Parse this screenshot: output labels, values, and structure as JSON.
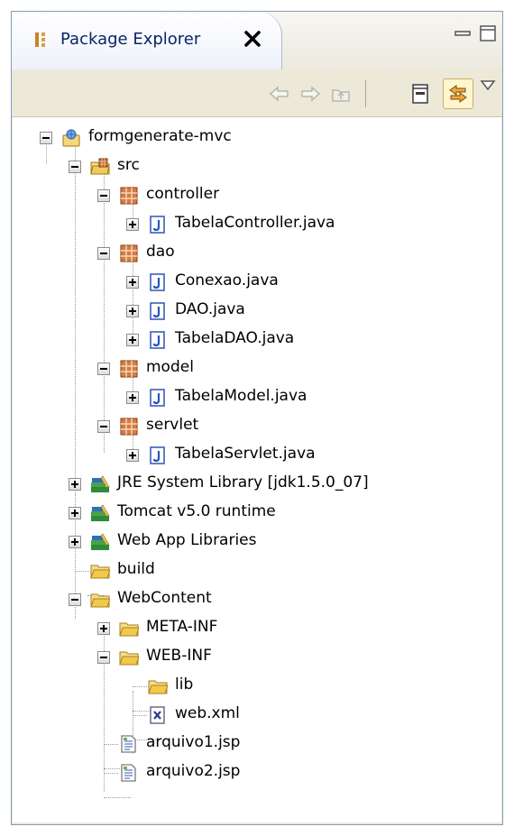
{
  "view": {
    "tab_title": "Package Explorer",
    "tab_close_icon": "close-x-icon",
    "minimize_icon": "minimize-icon",
    "maximize_icon": "maximize-icon"
  },
  "toolbar": {
    "back_icon": "back-arrow-icon",
    "forward_icon": "forward-arrow-icon",
    "up_icon": "up-folder-icon",
    "collapse_all_icon": "collapse-all-icon",
    "link_with_editor_icon": "link-with-editor-icon",
    "view_menu_icon": "view-menu-icon"
  },
  "tree": [
    {
      "label": "formgenerate-mvc",
      "icon": "web-project",
      "expander": "minus"
    },
    {
      "label": "src",
      "icon": "source-folder",
      "expander": "minus"
    },
    {
      "label": "controller",
      "icon": "package",
      "expander": "minus"
    },
    {
      "label": "TabelaController.java",
      "icon": "java-file",
      "expander": "plus"
    },
    {
      "label": "dao",
      "icon": "package",
      "expander": "minus"
    },
    {
      "label": "Conexao.java",
      "icon": "java-file",
      "expander": "plus"
    },
    {
      "label": "DAO.java",
      "icon": "java-file",
      "expander": "plus"
    },
    {
      "label": "TabelaDAO.java",
      "icon": "java-file",
      "expander": "plus"
    },
    {
      "label": "model",
      "icon": "package",
      "expander": "minus"
    },
    {
      "label": "TabelaModel.java",
      "icon": "java-file",
      "expander": "plus"
    },
    {
      "label": "servlet",
      "icon": "package",
      "expander": "minus"
    },
    {
      "label": "TabelaServlet.java",
      "icon": "java-file",
      "expander": "plus"
    },
    {
      "label": "JRE System Library [jdk1.5.0_07]",
      "icon": "library",
      "expander": "plus"
    },
    {
      "label": "Tomcat v5.0 runtime",
      "icon": "library",
      "expander": "plus"
    },
    {
      "label": "Web App Libraries",
      "icon": "library",
      "expander": "plus"
    },
    {
      "label": "build",
      "icon": "folder",
      "expander": "none"
    },
    {
      "label": "WebContent",
      "icon": "folder",
      "expander": "minus"
    },
    {
      "label": "META-INF",
      "icon": "folder",
      "expander": "plus"
    },
    {
      "label": "WEB-INF",
      "icon": "folder",
      "expander": "minus"
    },
    {
      "label": "lib",
      "icon": "folder",
      "expander": "none"
    },
    {
      "label": "web.xml",
      "icon": "xml-file",
      "expander": "none"
    },
    {
      "label": "arquivo1.jsp",
      "icon": "jsp-file",
      "expander": "none"
    },
    {
      "label": "arquivo2.jsp",
      "icon": "jsp-file",
      "expander": "none"
    }
  ],
  "colors": {
    "frame_border": "#7f9db9",
    "tab_text": "#0a246a",
    "package_icon": "#a0471c",
    "java_icon": "#2a55b8",
    "folder_icon": "#f2c94c",
    "library_green": "#2e8b3a"
  }
}
